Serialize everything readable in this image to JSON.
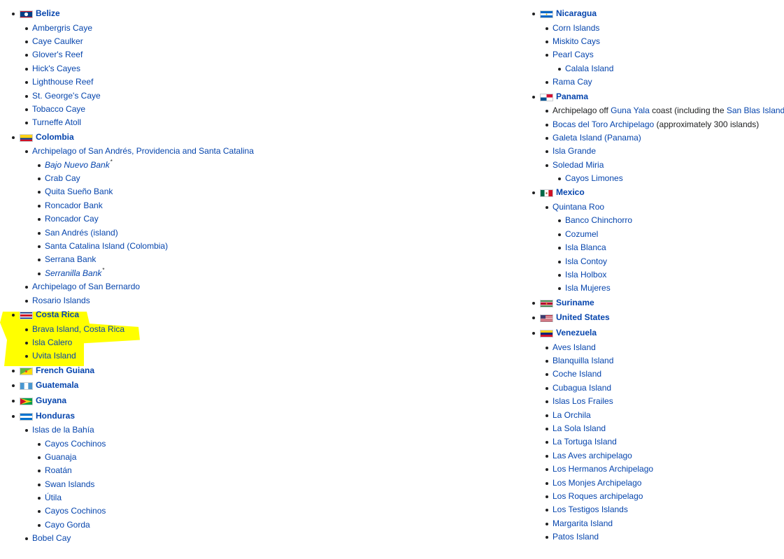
{
  "left": [
    {
      "type": "country",
      "flag": "belize",
      "label": "Belize",
      "children": [
        {
          "label": "Ambergris Caye"
        },
        {
          "label": "Caye Caulker"
        },
        {
          "label": "Glover's Reef"
        },
        {
          "label": "Hick's Cayes"
        },
        {
          "label": "Lighthouse Reef"
        },
        {
          "label": "St. George's Caye"
        },
        {
          "label": "Tobacco Caye"
        },
        {
          "label": "Turneffe Atoll"
        }
      ]
    },
    {
      "type": "country",
      "flag": "colombia",
      "label": "Colombia",
      "children": [
        {
          "label": "Archipelago of San Andrés, Providencia and Santa Catalina",
          "children": [
            {
              "label": "Bajo Nuevo Bank",
              "italic": true,
              "mark": "*"
            },
            {
              "label": "Crab Cay"
            },
            {
              "label": "Quita Sueño Bank"
            },
            {
              "label": "Roncador Bank"
            },
            {
              "label": "Roncador Cay"
            },
            {
              "label": "San Andrés (island)"
            },
            {
              "label": "Santa Catalina Island (Colombia)"
            },
            {
              "label": "Serrana Bank"
            },
            {
              "label": "Serranilla Bank",
              "italic": true,
              "mark": "*"
            }
          ]
        },
        {
          "label": "Archipelago of San Bernardo"
        },
        {
          "label": "Rosario Islands"
        }
      ]
    },
    {
      "type": "country",
      "flag": "costarica",
      "label": "Costa Rica",
      "children": [
        {
          "label": "Brava Island, Costa Rica"
        },
        {
          "label": "Isla Calero"
        },
        {
          "label": "Uvita Island"
        }
      ]
    },
    {
      "type": "country",
      "flag": "frenchguiana",
      "label": "French Guiana"
    },
    {
      "type": "country",
      "flag": "guatemala",
      "label": "Guatemala"
    },
    {
      "type": "country",
      "flag": "guyana",
      "label": "Guyana"
    },
    {
      "type": "country",
      "flag": "honduras",
      "label": "Honduras",
      "children": [
        {
          "label": "Islas de la Bahía",
          "children": [
            {
              "label": "Cayos Cochinos"
            },
            {
              "label": "Guanaja"
            },
            {
              "label": "Roatán"
            },
            {
              "label": "Swan Islands"
            },
            {
              "label": "Útila"
            },
            {
              "label": "Cayos Cochinos"
            },
            {
              "label": "Cayo Gorda"
            }
          ]
        },
        {
          "label": "Bobel Cay"
        }
      ]
    }
  ],
  "right": [
    {
      "type": "country",
      "flag": "nicaragua",
      "label": "Nicaragua",
      "children": [
        {
          "label": "Corn Islands"
        },
        {
          "label": "Miskito Cays"
        },
        {
          "label": "Pearl Cays",
          "children": [
            {
              "label": "Calala Island"
            }
          ]
        },
        {
          "label": "Rama Cay"
        }
      ]
    },
    {
      "type": "country",
      "flag": "panama",
      "label": "Panama",
      "children": [
        {
          "segments": [
            {
              "text": "Archipelago off ",
              "link": false
            },
            {
              "text": "Guna Yala",
              "link": true
            },
            {
              "text": " coast (including the ",
              "link": false
            },
            {
              "text": "San Blas Islands",
              "link": true
            },
            {
              "text": ")",
              "link": false
            }
          ]
        },
        {
          "segments": [
            {
              "text": "Bocas del Toro Archipelago",
              "link": true
            },
            {
              "text": " (approximately 300 islands)",
              "link": false
            }
          ]
        },
        {
          "label": "Galeta Island (Panama)"
        },
        {
          "label": "Isla Grande"
        },
        {
          "label": "Soledad Miria",
          "children": [
            {
              "label": "Cayos Limones"
            }
          ]
        }
      ]
    },
    {
      "type": "country",
      "flag": "mexico",
      "label": "Mexico",
      "children": [
        {
          "label": "Quintana Roo",
          "children": [
            {
              "label": "Banco Chinchorro"
            },
            {
              "label": "Cozumel"
            },
            {
              "label": "Isla Blanca"
            },
            {
              "label": "Isla Contoy"
            },
            {
              "label": "Isla Holbox"
            },
            {
              "label": "Isla Mujeres"
            }
          ]
        }
      ]
    },
    {
      "type": "country",
      "flag": "suriname",
      "label": "Suriname"
    },
    {
      "type": "country",
      "flag": "usa",
      "label": "United States"
    },
    {
      "type": "country",
      "flag": "venezuela",
      "label": "Venezuela",
      "children": [
        {
          "label": "Aves Island"
        },
        {
          "label": "Blanquilla Island"
        },
        {
          "label": "Coche Island"
        },
        {
          "label": "Cubagua Island"
        },
        {
          "label": "Islas Los Frailes"
        },
        {
          "label": "La Orchila"
        },
        {
          "label": "La Sola Island"
        },
        {
          "label": "La Tortuga Island"
        },
        {
          "label": "Las Aves archipelago"
        },
        {
          "label": "Los Hermanos Archipelago"
        },
        {
          "label": "Los Monjes Archipelago"
        },
        {
          "label": "Los Roques archipelago"
        },
        {
          "label": "Los Testigos Islands"
        },
        {
          "label": "Margarita Island"
        },
        {
          "label": "Patos Island"
        }
      ]
    }
  ],
  "colors": {
    "link": "#0645ad",
    "text": "#202122",
    "highlight": "#ffff00"
  }
}
